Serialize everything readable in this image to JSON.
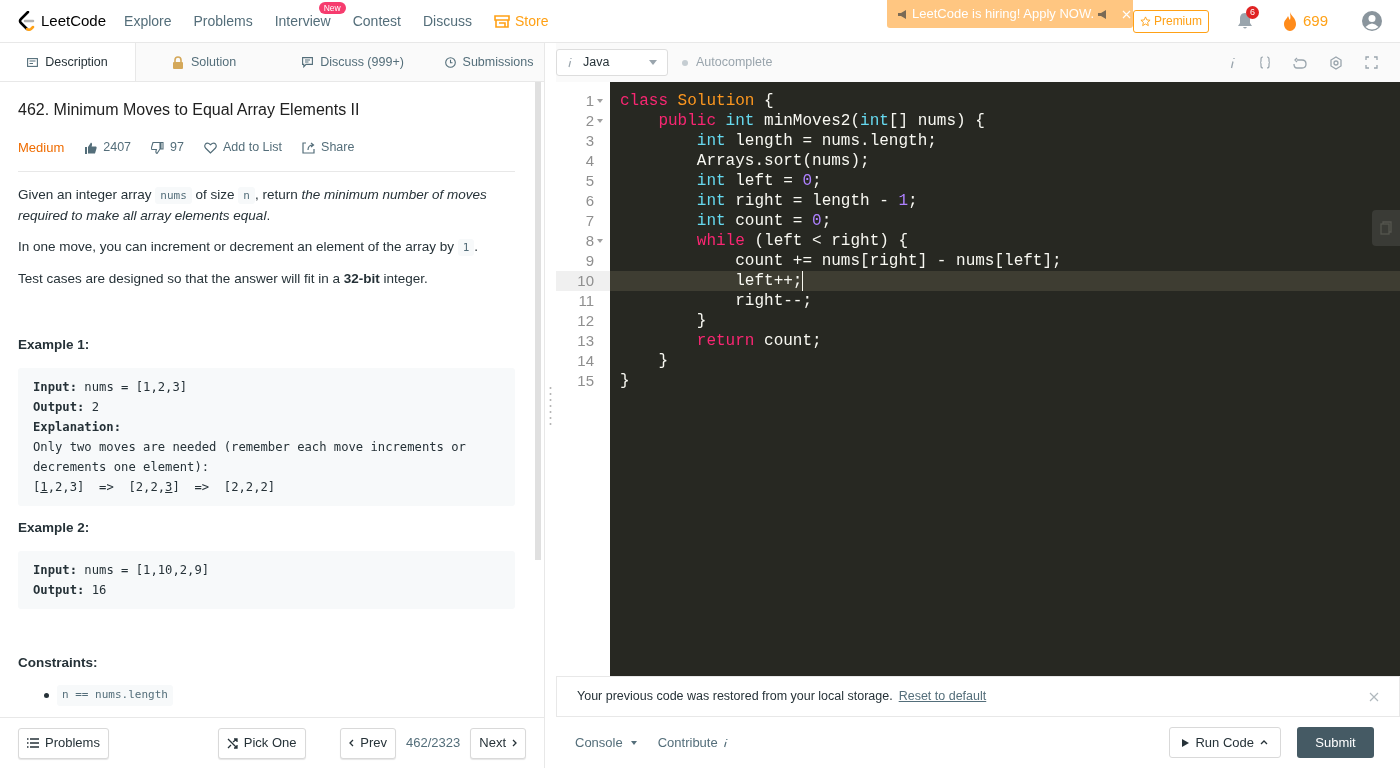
{
  "nav": {
    "logo": "LeetCode",
    "items": [
      {
        "label": "Explore",
        "highlight": false
      },
      {
        "label": "Problems",
        "highlight": false
      },
      {
        "label": "Interview",
        "highlight": false,
        "badge": "New"
      },
      {
        "label": "Contest",
        "highlight": false
      },
      {
        "label": "Discuss",
        "highlight": false
      },
      {
        "label": "Store",
        "highlight": true
      }
    ],
    "banner": {
      "text": "LeetCode is hiring! Apply NOW."
    },
    "premium": "Premium",
    "notifications": "6",
    "streak": "699"
  },
  "tabs": [
    {
      "label": "Description",
      "selected": true
    },
    {
      "label": "Solution",
      "selected": false
    },
    {
      "label": "Discuss (999+)",
      "selected": false
    },
    {
      "label": "Submissions",
      "selected": false
    }
  ],
  "problem": {
    "title": "462. Minimum Moves to Equal Array Elements II",
    "difficulty": "Medium",
    "likes": "2407",
    "dislikes": "97",
    "actions": [
      "Add to List",
      "Share"
    ],
    "paragraphs": [
      [
        {
          "kind": "text",
          "text": "Given an integer array "
        },
        {
          "kind": "code",
          "text": "nums"
        },
        {
          "kind": "text",
          "text": " of size "
        },
        {
          "kind": "code",
          "text": "n"
        },
        {
          "kind": "text",
          "text": ", return "
        },
        {
          "kind": "italic",
          "text": "the minimum number of moves required to make all array elements equal"
        },
        {
          "kind": "text",
          "text": "."
        }
      ],
      [
        {
          "kind": "text",
          "text": "In one move, you can increment or decrement an element of the array by "
        },
        {
          "kind": "code",
          "text": "1"
        },
        {
          "kind": "text",
          "text": "."
        }
      ],
      [
        {
          "kind": "text",
          "text": "Test cases are designed so that the answer will fit in a "
        },
        {
          "kind": "bold",
          "text": "32-bit"
        },
        {
          "kind": "text",
          "text": " integer."
        }
      ]
    ],
    "examples": [
      {
        "title": "Example 1:",
        "lines": [
          [
            {
              "kind": "bold",
              "text": "Input:"
            },
            {
              "kind": "text",
              "text": " nums = [1,2,3]"
            }
          ],
          [
            {
              "kind": "bold",
              "text": "Output:"
            },
            {
              "kind": "text",
              "text": " 2"
            }
          ],
          [
            {
              "kind": "bold",
              "text": "Explanation:"
            }
          ],
          [
            {
              "kind": "text",
              "text": "Only two moves are needed (remember each move increments or decrements one element):"
            }
          ],
          [
            {
              "kind": "text",
              "text": "["
            },
            {
              "kind": "underline",
              "text": "1"
            },
            {
              "kind": "text",
              "text": ",2,3]  =>  [2,2,"
            },
            {
              "kind": "underline",
              "text": "3"
            },
            {
              "kind": "text",
              "text": "]  =>  [2,2,2]"
            }
          ]
        ]
      },
      {
        "title": "Example 2:",
        "lines": [
          [
            {
              "kind": "bold",
              "text": "Input:"
            },
            {
              "kind": "text",
              "text": " nums = [1,10,2,9]"
            }
          ],
          [
            {
              "kind": "bold",
              "text": "Output:"
            },
            {
              "kind": "text",
              "text": " 16"
            }
          ]
        ]
      }
    ],
    "constraints_title": "Constraints:",
    "constraints": [
      "n == nums.length"
    ]
  },
  "editor": {
    "language": "Java",
    "autocomplete": {
      "label": "Autocomplete",
      "on": false
    },
    "lines": [
      {
        "number": "1",
        "foldable": true,
        "active": false,
        "tokens": [
          {
            "kind": "keyword",
            "text": "class"
          },
          {
            "kind": "name",
            "text": " Solution"
          },
          {
            "kind": "plain",
            "text": " {"
          }
        ]
      },
      {
        "number": "2",
        "foldable": true,
        "active": false,
        "tokens": [
          {
            "kind": "keyword",
            "text": "    public"
          },
          {
            "kind": "type",
            "text": " int"
          },
          {
            "kind": "plain",
            "text": " minMoves2("
          },
          {
            "kind": "type",
            "text": "int"
          },
          {
            "kind": "plain",
            "text": "[] nums) {"
          }
        ]
      },
      {
        "number": "3",
        "foldable": false,
        "active": false,
        "tokens": [
          {
            "kind": "type",
            "text": "        int"
          },
          {
            "kind": "plain",
            "text": " length = nums.length;"
          }
        ]
      },
      {
        "number": "4",
        "foldable": false,
        "active": false,
        "tokens": [
          {
            "kind": "plain",
            "text": "        Arrays.sort(nums);"
          }
        ]
      },
      {
        "number": "5",
        "foldable": false,
        "active": false,
        "tokens": [
          {
            "kind": "type",
            "text": "        int"
          },
          {
            "kind": "plain",
            "text": " left = "
          },
          {
            "kind": "number",
            "text": "0"
          },
          {
            "kind": "plain",
            "text": ";"
          }
        ]
      },
      {
        "number": "6",
        "foldable": false,
        "active": false,
        "tokens": [
          {
            "kind": "type",
            "text": "        int"
          },
          {
            "kind": "plain",
            "text": " right = length - "
          },
          {
            "kind": "number",
            "text": "1"
          },
          {
            "kind": "plain",
            "text": ";"
          }
        ]
      },
      {
        "number": "7",
        "foldable": false,
        "active": false,
        "tokens": [
          {
            "kind": "type",
            "text": "        int"
          },
          {
            "kind": "plain",
            "text": " count = "
          },
          {
            "kind": "number",
            "text": "0"
          },
          {
            "kind": "plain",
            "text": ";"
          }
        ]
      },
      {
        "number": "8",
        "foldable": true,
        "active": false,
        "tokens": [
          {
            "kind": "keyword",
            "text": "        while"
          },
          {
            "kind": "plain",
            "text": " (left < right) {"
          }
        ]
      },
      {
        "number": "9",
        "foldable": false,
        "active": false,
        "tokens": [
          {
            "kind": "plain",
            "text": "            count += nums[right] - nums[left];"
          }
        ]
      },
      {
        "number": "10",
        "foldable": false,
        "active": true,
        "tokens": [
          {
            "kind": "plain",
            "text": "            left++;"
          }
        ]
      },
      {
        "number": "11",
        "foldable": false,
        "active": false,
        "tokens": [
          {
            "kind": "plain",
            "text": "            right--;"
          }
        ]
      },
      {
        "number": "12",
        "foldable": false,
        "active": false,
        "tokens": [
          {
            "kind": "plain",
            "text": "        }"
          }
        ]
      },
      {
        "number": "13",
        "foldable": false,
        "active": false,
        "tokens": [
          {
            "kind": "keyword",
            "text": "        return"
          },
          {
            "kind": "plain",
            "text": " count;"
          }
        ]
      },
      {
        "number": "14",
        "foldable": false,
        "active": false,
        "tokens": [
          {
            "kind": "plain",
            "text": "    }"
          }
        ]
      },
      {
        "number": "15",
        "foldable": false,
        "active": false,
        "tokens": [
          {
            "kind": "plain",
            "text": "}"
          }
        ]
      }
    ]
  },
  "notice": {
    "text": "Your previous code was restored from your local storage.",
    "link": "Reset to default"
  },
  "footer_left": {
    "problems": "Problems",
    "pick": "Pick One",
    "prev": "Prev",
    "position": "462/2323",
    "next": "Next"
  },
  "footer_right": {
    "console": "Console",
    "contribute": "Contribute",
    "run": "Run Code",
    "submit": "Submit"
  }
}
